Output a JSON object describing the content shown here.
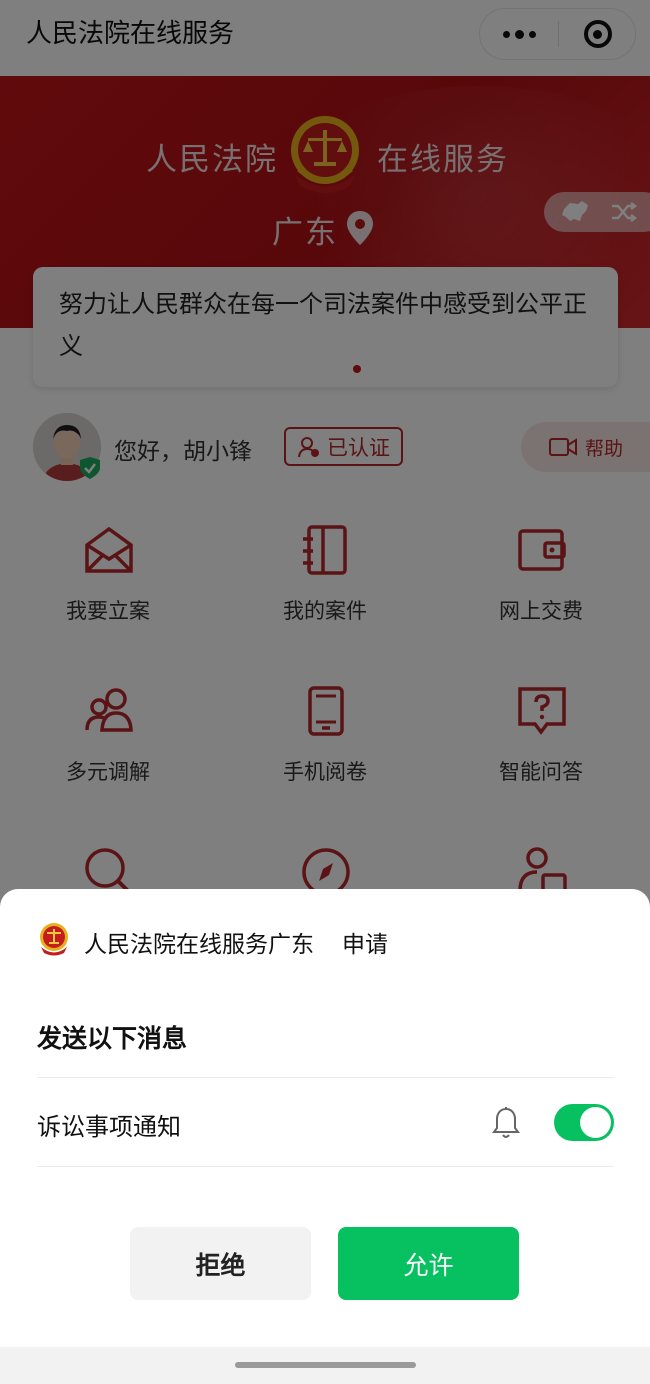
{
  "navbar": {
    "title": "人民法院在线服务",
    "more_icon": "more-dots-icon",
    "close_icon": "close-miniprogram-icon"
  },
  "banner": {
    "title_left": "人民法院",
    "title_right": "在线服务",
    "region": "广东",
    "emblem_icon": "court-emblem-icon",
    "location_icon": "location-pin-icon",
    "switch_icons": [
      "china-map-icon",
      "shuffle-icon"
    ]
  },
  "slogan": {
    "text": "努力让人民群众在每一个司法案件中感受到公平正义"
  },
  "user": {
    "greeting": "您好，胡小锋",
    "verified_label": "已认证",
    "help_label": "帮助"
  },
  "grid": {
    "items": [
      {
        "label": "我要立案",
        "icon": "envelope-icon"
      },
      {
        "label": "我的案件",
        "icon": "notebook-icon"
      },
      {
        "label": "网上交费",
        "icon": "wallet-icon"
      },
      {
        "label": "多元调解",
        "icon": "people-icon"
      },
      {
        "label": "手机阅卷",
        "icon": "phone-icon"
      },
      {
        "label": "智能问答",
        "icon": "question-chat-icon"
      }
    ]
  },
  "sheet": {
    "app_name": "人民法院在线服务广东",
    "request_label": "申请",
    "heading": "发送以下消息",
    "item_label": "诉讼事项通知",
    "toggle_on": true,
    "reject_label": "拒绝",
    "allow_label": "允许"
  },
  "colors": {
    "brand_red": "#c2151a",
    "wechat_green": "#07c160",
    "reject_bg": "#f2f2f2"
  }
}
